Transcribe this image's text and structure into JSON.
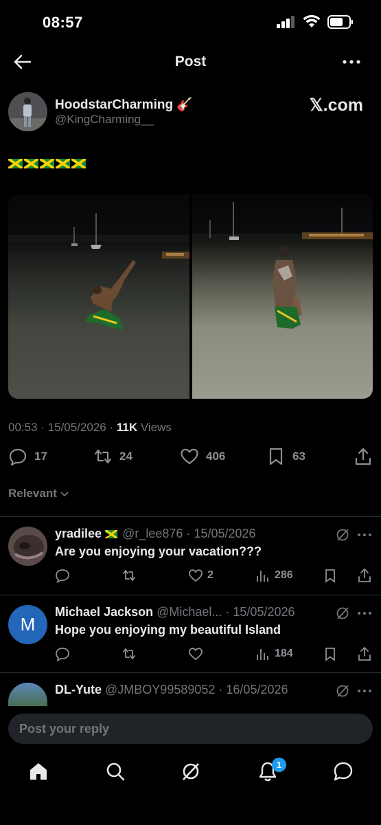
{
  "status_bar": {
    "time": "08:57"
  },
  "nav": {
    "title": "Post"
  },
  "post": {
    "author_name": "HoodstarCharming",
    "author_emoji": "🎸",
    "author_handle": "@KingCharming__",
    "source_mark": "𝕏.com",
    "flags_count": 5,
    "time": "00:53",
    "date": "15/05/2026",
    "views_count": "11K",
    "views_label": "Views",
    "replies": "17",
    "reposts": "24",
    "likes": "406",
    "bookmarks": "63"
  },
  "sort": {
    "label": "Relevant"
  },
  "replies": [
    {
      "name": "yradilee",
      "handle": "@r_lee876",
      "date": "15/05/2026",
      "text": "Are you enjoying your vacation???",
      "likes": "2",
      "views": "286"
    },
    {
      "name": "Michael Jackson",
      "handle": "@Michael...",
      "date": "15/05/2026",
      "avatar_letter": "M",
      "text": "Hope you enjoying my beautiful Island",
      "likes": "",
      "views": "184"
    },
    {
      "name": "DL-Yute",
      "handle": "@JMBOY99589052",
      "date": "16/05/2026",
      "text": ""
    }
  ],
  "compose": {
    "placeholder": "Post your reply"
  },
  "tabbar": {
    "notifications_badge": "1"
  },
  "colors": {
    "accent": "#1d9bf0",
    "background": "#000000",
    "muted": "#71767b"
  }
}
